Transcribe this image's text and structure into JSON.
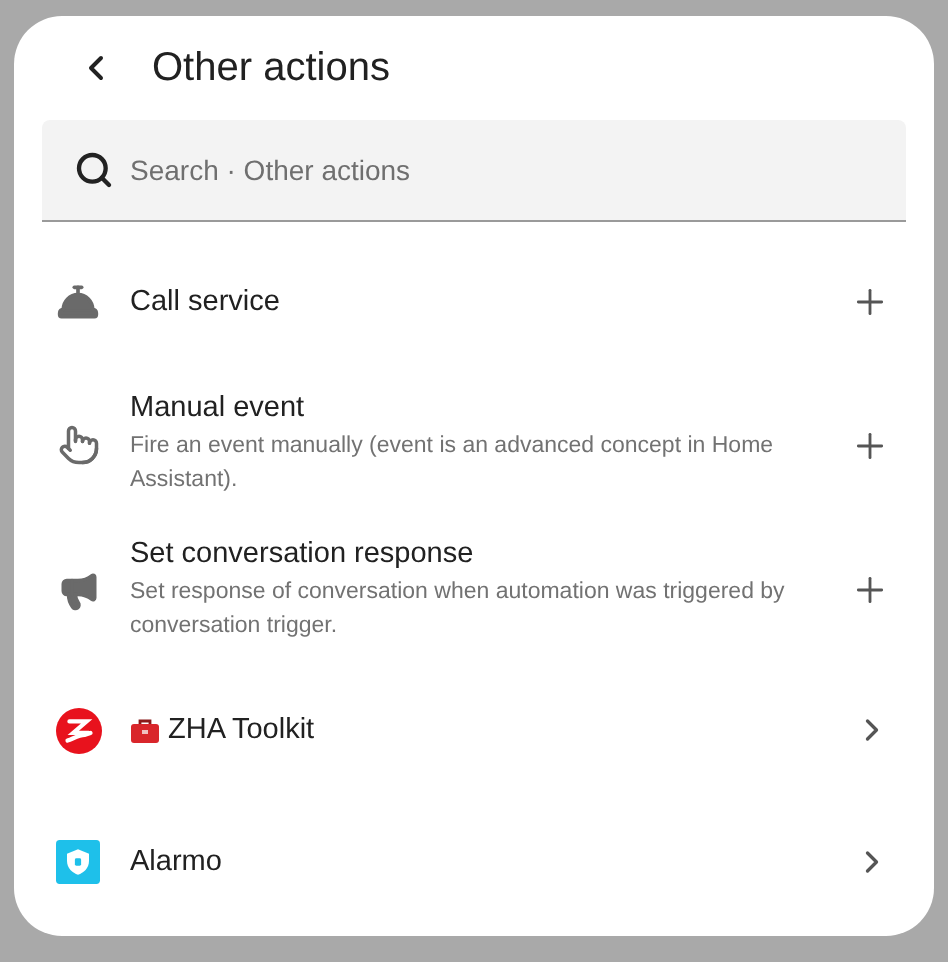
{
  "header": {
    "title": "Other actions"
  },
  "search": {
    "placeholder": "Search · Other actions"
  },
  "items": [
    {
      "kind": "action",
      "title": "Call service"
    },
    {
      "kind": "action",
      "title": "Manual event",
      "description": "Fire an event manually (event is an advanced concept in Home Assistant)."
    },
    {
      "kind": "action",
      "title": "Set conversation response",
      "description": "Set response of conversation when automation was triggered by conversation trigger."
    },
    {
      "kind": "group",
      "title": "ZHA Toolkit"
    },
    {
      "kind": "group",
      "title": "Alarmo"
    }
  ]
}
